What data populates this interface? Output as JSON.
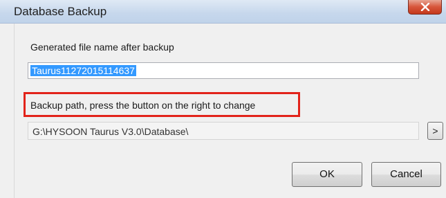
{
  "window": {
    "title": "Database Backup",
    "close_icon": "close-icon"
  },
  "filename": {
    "label": "Generated file name after backup",
    "value": "Taurus11272015114637"
  },
  "backup_path": {
    "label": "Backup path, press the button on the right to change",
    "value": "G:\\HYSOON Taurus V3.0\\Database\\",
    "browse_label": ">"
  },
  "buttons": {
    "ok": "OK",
    "cancel": "Cancel"
  },
  "colors": {
    "highlight": "#e2231a",
    "selection": "#3399ff"
  }
}
